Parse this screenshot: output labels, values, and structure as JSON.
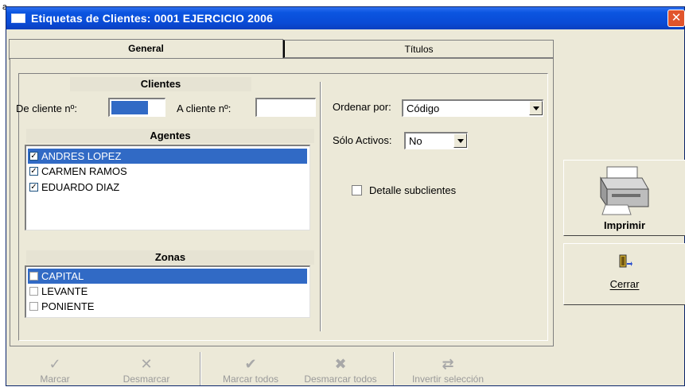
{
  "window": {
    "title": "Etiquetas de Clientes: 0001 EJERCICIO 2006",
    "close_glyph": "✕"
  },
  "tabs": [
    {
      "label": "General",
      "active": true
    },
    {
      "label": "Títulos",
      "active": false
    }
  ],
  "clientes": {
    "header": "Clientes",
    "from_label": "De cliente nº:",
    "from_value": "",
    "to_label": "A cliente nº:",
    "to_value": ""
  },
  "agentes": {
    "header": "Agentes",
    "items": [
      {
        "label": "ANDRES LOPEZ",
        "checked": true,
        "selected": true
      },
      {
        "label": "CARMEN RAMOS",
        "checked": true,
        "selected": false
      },
      {
        "label": "EDUARDO DIAZ",
        "checked": true,
        "selected": false
      }
    ]
  },
  "zonas": {
    "header": "Zonas",
    "items": [
      {
        "label": "CAPITAL",
        "checked": false,
        "selected": true
      },
      {
        "label": "LEVANTE",
        "checked": false,
        "selected": false
      },
      {
        "label": "PONIENTE",
        "checked": false,
        "selected": false
      }
    ]
  },
  "options": {
    "order_label": "Ordenar por:",
    "order_value": "Código",
    "active_label": "Sólo Activos:",
    "active_value": "No",
    "detail_label": "Detalle subclientes",
    "detail_checked": false
  },
  "side_buttons": {
    "print_label": "Imprimir",
    "close_label": "Cerrar",
    "print_icon": "printer-icon",
    "close_icon": "exit-door-icon"
  },
  "toolbar": {
    "items": [
      {
        "label": "Marcar",
        "icon": "check-icon",
        "glyph": "✓"
      },
      {
        "label": "Desmarcar",
        "icon": "x-mark-icon",
        "glyph": "✕"
      },
      {
        "label": "Marcar todos",
        "icon": "check-all-icon",
        "glyph": "✔"
      },
      {
        "label": "Desmarcar todos",
        "icon": "uncheck-all-icon",
        "glyph": "✖"
      },
      {
        "label": "Invertir selección",
        "icon": "invert-icon",
        "glyph": "⇄"
      }
    ]
  },
  "colors": {
    "titlebar": "#0a4bd6",
    "selection": "#316ac5",
    "dialog_bg": "#ece9d8",
    "close_button": "#e1542b"
  }
}
